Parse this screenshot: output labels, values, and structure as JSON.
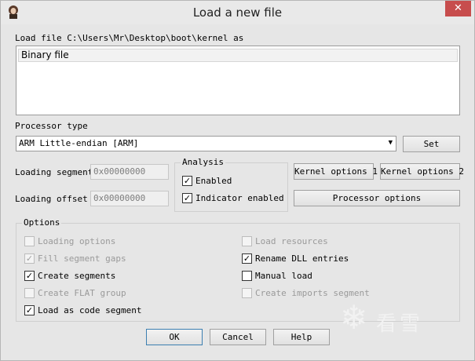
{
  "window": {
    "title": "Load a new file",
    "close_glyph": "✕"
  },
  "load_file": {
    "label": "Load file C:\\Users\\Mr\\Desktop\\boot\\kernel as",
    "formats": [
      "Binary file"
    ]
  },
  "processor": {
    "label": "Processor type",
    "selected": "ARM Little-endian [ARM]",
    "set_label": "Set"
  },
  "loading": {
    "segment_label": "Loading segment",
    "segment_value": "0x00000000",
    "offset_label": "Loading offset",
    "offset_value": "0x00000000"
  },
  "analysis": {
    "title": "Analysis",
    "enabled_label": "Enabled",
    "enabled_checked": true,
    "indicator_label": "Indicator enabled",
    "indicator_checked": true
  },
  "buttons": {
    "kernel1": "Kernel options 1",
    "kernel2": "Kernel options 2",
    "processor_options": "Processor options",
    "ok": "OK",
    "cancel": "Cancel",
    "help": "Help"
  },
  "options": {
    "title": "Options",
    "loading_options": "Loading options",
    "fill_segment_gaps": "Fill segment gaps",
    "create_segments": "Create segments",
    "create_flat_group": "Create FLAT group",
    "load_as_code_segment": "Load as code segment",
    "load_resources": "Load resources",
    "rename_dll_entries": "Rename DLL entries",
    "manual_load": "Manual load",
    "create_imports_segment": "Create imports segment"
  },
  "watermark": {
    "text": "看雪",
    "icon": "snowflake-icon"
  },
  "icons": {
    "app": "app-avatar-icon",
    "close": "close-icon",
    "dropdown": "chevron-down-icon",
    "check": "checkmark-icon"
  }
}
